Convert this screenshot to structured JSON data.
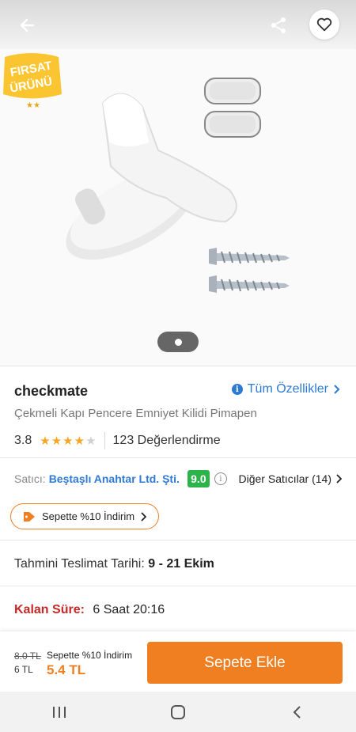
{
  "header": {
    "back_icon": "arrow-left-icon",
    "share_icon": "share-icon",
    "favorite_icon": "heart-outline-icon"
  },
  "badge": {
    "line1": "FIRSAT",
    "line2": "ÜRÜNÜ"
  },
  "gallery": {
    "image_count": 1,
    "current": 1
  },
  "product": {
    "brand": "checkmate",
    "all_specs_label": "Tüm Özellikler",
    "title": "Çekmeli Kapı Pencere Emniyet Kilidi Pimapen",
    "rating": "3.8",
    "stars_filled": 4,
    "stars_total": 5,
    "review_count_label": "123 Değerlendirme"
  },
  "seller": {
    "label": "Satıcı:",
    "name": "Beştaşlı Anahtar Ltd. Şti.",
    "score": "9.0",
    "other_sellers_label": "Diğer Satıcılar (14)"
  },
  "promo": {
    "label": "Sepette %10 İndirim"
  },
  "delivery": {
    "label": "Tahmini Teslimat Tarihi:",
    "value": "9 - 21 Ekim"
  },
  "countdown": {
    "label": "Kalan Süre:",
    "value": "6 Saat 20:16"
  },
  "checkout": {
    "old_price": "8.0 TL",
    "price": "6 TL",
    "promo_label": "Sepette %10 İndirim",
    "promo_price": "5.4 TL",
    "add_to_cart_label": "Sepete Ekle"
  },
  "colors": {
    "accent": "#f07f21",
    "link": "#2d7bd5",
    "score": "#2cb34a",
    "timer": "#c62828"
  }
}
